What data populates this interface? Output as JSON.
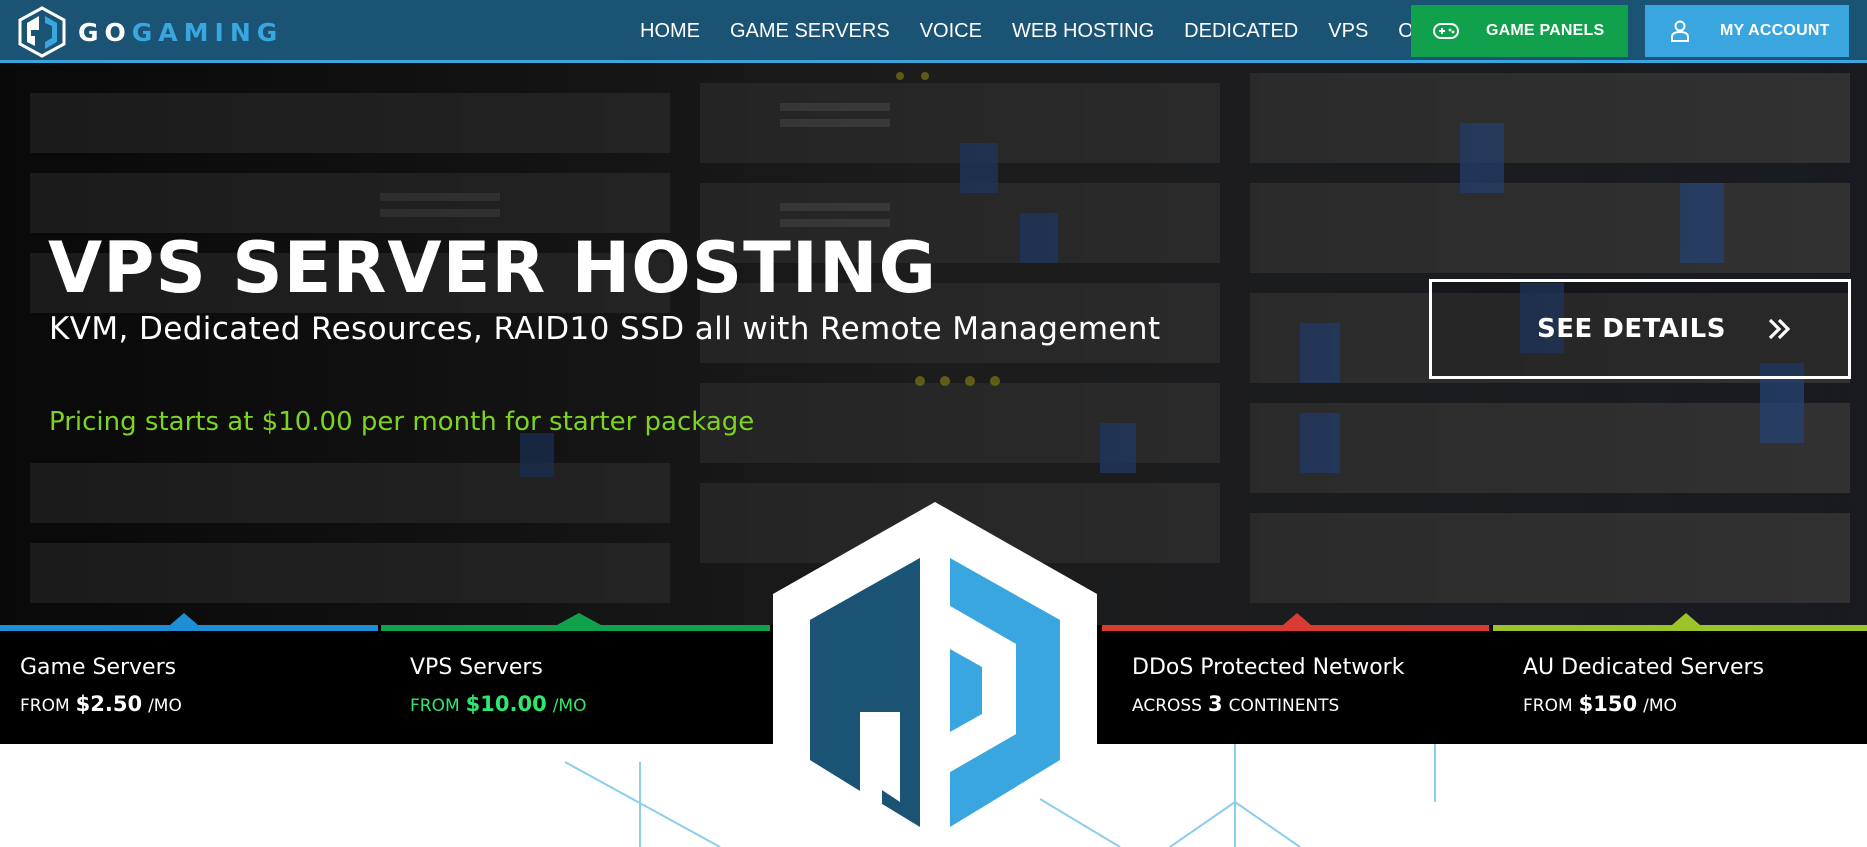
{
  "brand": {
    "go": "GO",
    "gaming": "GAMING",
    "logo_icon": "gogaming-logo-icon"
  },
  "nav": {
    "items": [
      {
        "label": "HOME"
      },
      {
        "label": "GAME SERVERS"
      },
      {
        "label": "VOICE"
      },
      {
        "label": "WEB HOSTING"
      },
      {
        "label": "DEDICATED"
      },
      {
        "label": "VPS"
      },
      {
        "label": "OTHER"
      }
    ],
    "game_panels": {
      "label": "GAME PANELS",
      "icon": "gamepad-icon",
      "color": "#11a04b"
    },
    "my_account": {
      "label": "MY ACCOUNT",
      "icon": "user-icon",
      "color": "#3aa6df"
    }
  },
  "hero": {
    "title": "VPS SERVER HOSTING",
    "subtitle": "KVM, Dedicated Resources, RAID10 SSD all with Remote Management",
    "pricing": "Pricing starts at $10.00 per month for starter package",
    "cta": {
      "label": "SEE DETAILS",
      "icon": "double-chevron-right-icon"
    }
  },
  "features": [
    {
      "title": "Game Servers",
      "prefix": "FROM",
      "value": "$2.50",
      "suffix": "/MO",
      "color": "#1e8fd6",
      "text_color": "#ffffff"
    },
    {
      "title": "VPS Servers",
      "prefix": "FROM",
      "value": "$10.00",
      "suffix": "/MO",
      "color": "#11a04b",
      "text_color": "#2ee86e"
    },
    {
      "title": "DDoS Protected Network",
      "prefix": "ACROSS",
      "value": "3",
      "suffix": "CONTINENTS",
      "color": "#d83a34",
      "text_color": "#ffffff"
    },
    {
      "title": "AU Dedicated Servers",
      "prefix": "FROM",
      "value": "$150",
      "suffix": "/MO",
      "color": "#9bc32a",
      "text_color": "#ffffff"
    }
  ],
  "colors": {
    "nav_bg": "#1b5374",
    "accent_blue": "#3aa6df",
    "dark_blue": "#1b5374",
    "pricing_green": "#7ed321"
  }
}
